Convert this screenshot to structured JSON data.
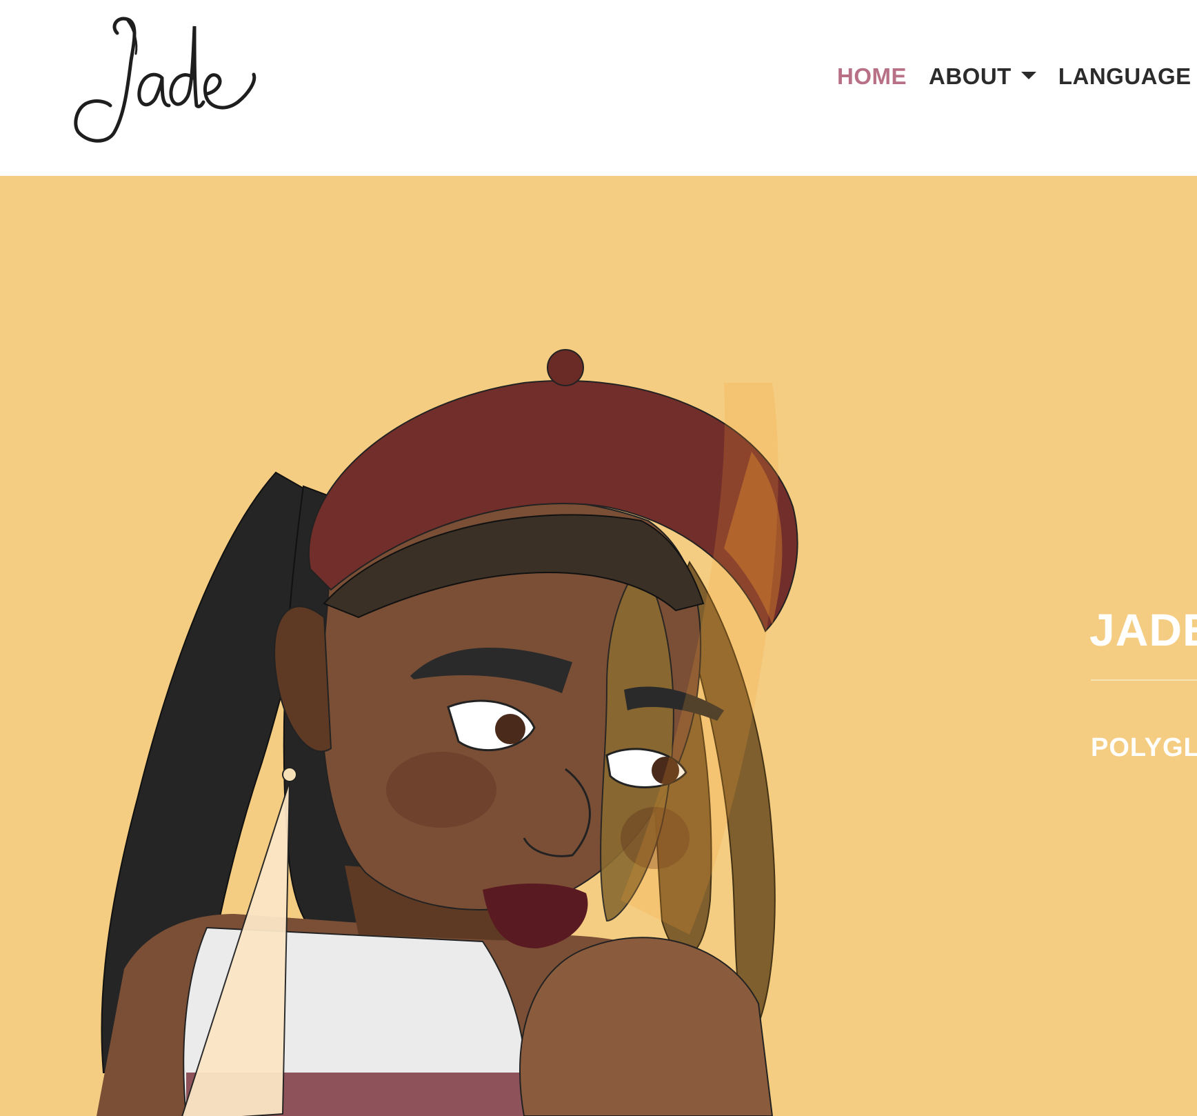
{
  "site": {
    "logo_text": "Jade"
  },
  "nav": {
    "items": [
      {
        "label": "HOME",
        "active": true
      },
      {
        "label": "ABOUT",
        "dropdown": true
      },
      {
        "label": "LANGUAGE"
      }
    ]
  },
  "hero": {
    "title": "JADE",
    "subtitle": "POLYGL",
    "background_color": "#f4cd82"
  },
  "colors": {
    "nav_active": "#b87086",
    "nav_text": "#2b2b2b",
    "hero_text": "#ffffff"
  }
}
